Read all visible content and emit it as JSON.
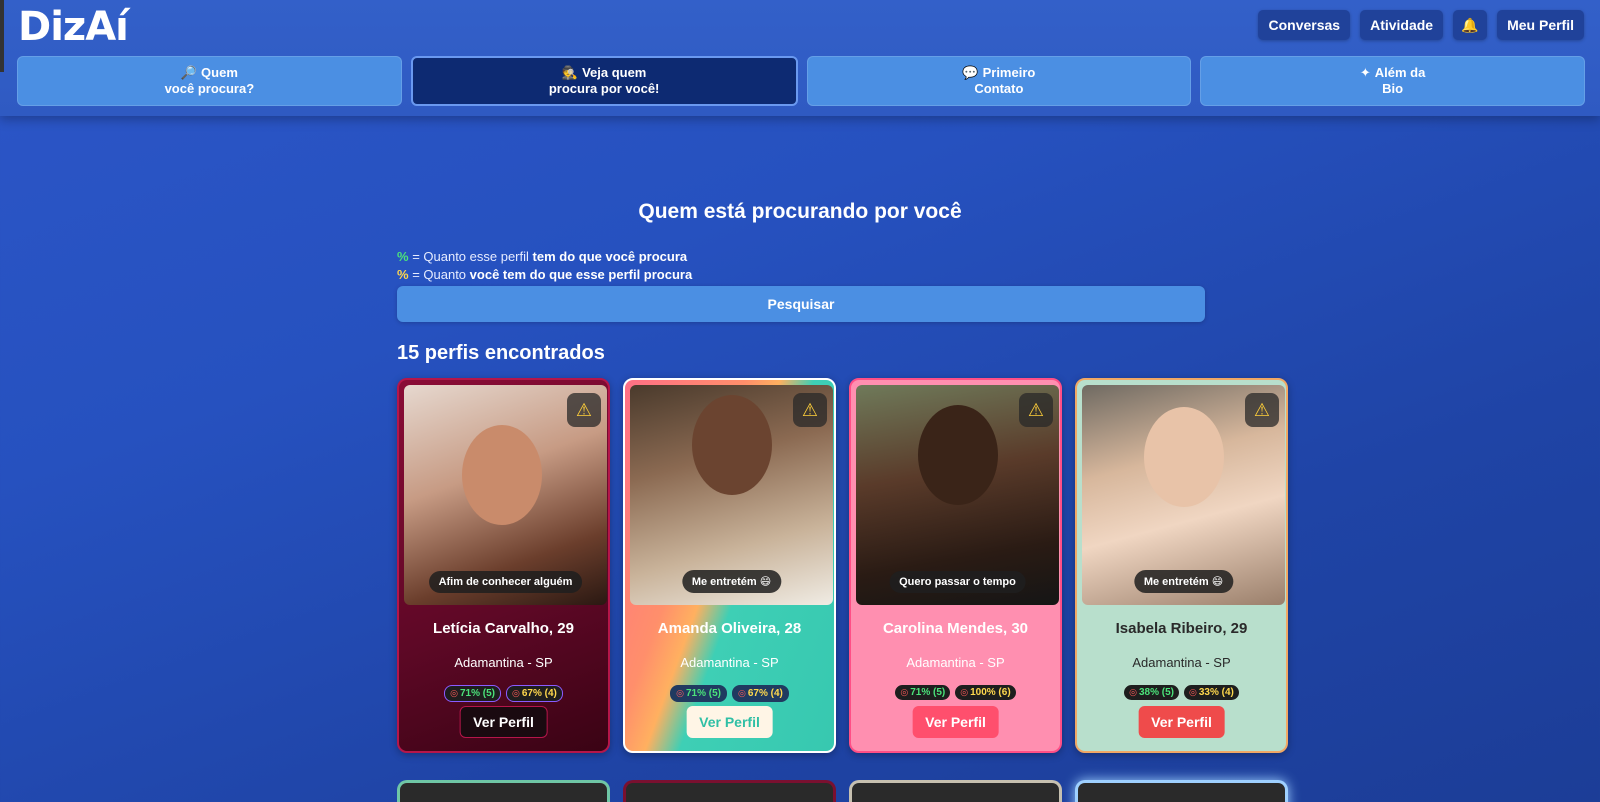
{
  "app": {
    "logo": "DizAí"
  },
  "header": {
    "conversas": "Conversas",
    "atividade": "Atividade",
    "bell_icon": "bell-icon",
    "meu_perfil": "Meu Perfil"
  },
  "tabs": [
    {
      "icon": "🔎",
      "line1": "Quem",
      "line2": "você procura?",
      "active": false
    },
    {
      "icon": "🕵️",
      "line1": "Veja quem",
      "line2": "procura por você!",
      "active": true
    },
    {
      "icon": "💬",
      "line1": "Primeiro",
      "line2": "Contato",
      "active": false
    },
    {
      "icon": "✦",
      "line1": "Além da",
      "line2": "Bio",
      "active": false
    }
  ],
  "main": {
    "title": "Quem está procurando por você",
    "legend1_prefix": "= Quanto esse perfil",
    "legend1_bold": "tem do que você procura",
    "legend2_prefix": "= Quanto",
    "legend2_bold": "você tem do que esse perfil procura",
    "percent_symbol": "%",
    "search_button": "Pesquisar",
    "results_count": "15 perfis encontrados"
  },
  "profiles": [
    {
      "name": "Letícia Carvalho, 29",
      "location": "Adamantina - SP",
      "mood": "Afim de conhecer alguém",
      "badge1": "71% (5)",
      "badge2": "67% (4)",
      "button": "Ver Perfil"
    },
    {
      "name": "Amanda Oliveira, 28",
      "location": "Adamantina - SP",
      "mood": "Me entretém 😄",
      "badge1": "71% (5)",
      "badge2": "67% (4)",
      "button": "Ver Perfil"
    },
    {
      "name": "Carolina Mendes, 30",
      "location": "Adamantina - SP",
      "mood": "Quero passar o tempo",
      "badge1": "71% (5)",
      "badge2": "100% (6)",
      "button": "Ver Perfil"
    },
    {
      "name": "Isabela Ribeiro, 29",
      "location": "Adamantina - SP",
      "mood": "Me entretém 😄",
      "badge1": "38% (5)",
      "badge2": "33% (4)",
      "button": "Ver Perfil"
    }
  ],
  "icons": {
    "warning": "warning-icon",
    "target": "target-icon"
  },
  "colors": {
    "accent": "#4b8fe3",
    "active_tab": "#0d2a72",
    "green_pct": "#4be37a",
    "yellow_pct": "#ffd84d"
  }
}
